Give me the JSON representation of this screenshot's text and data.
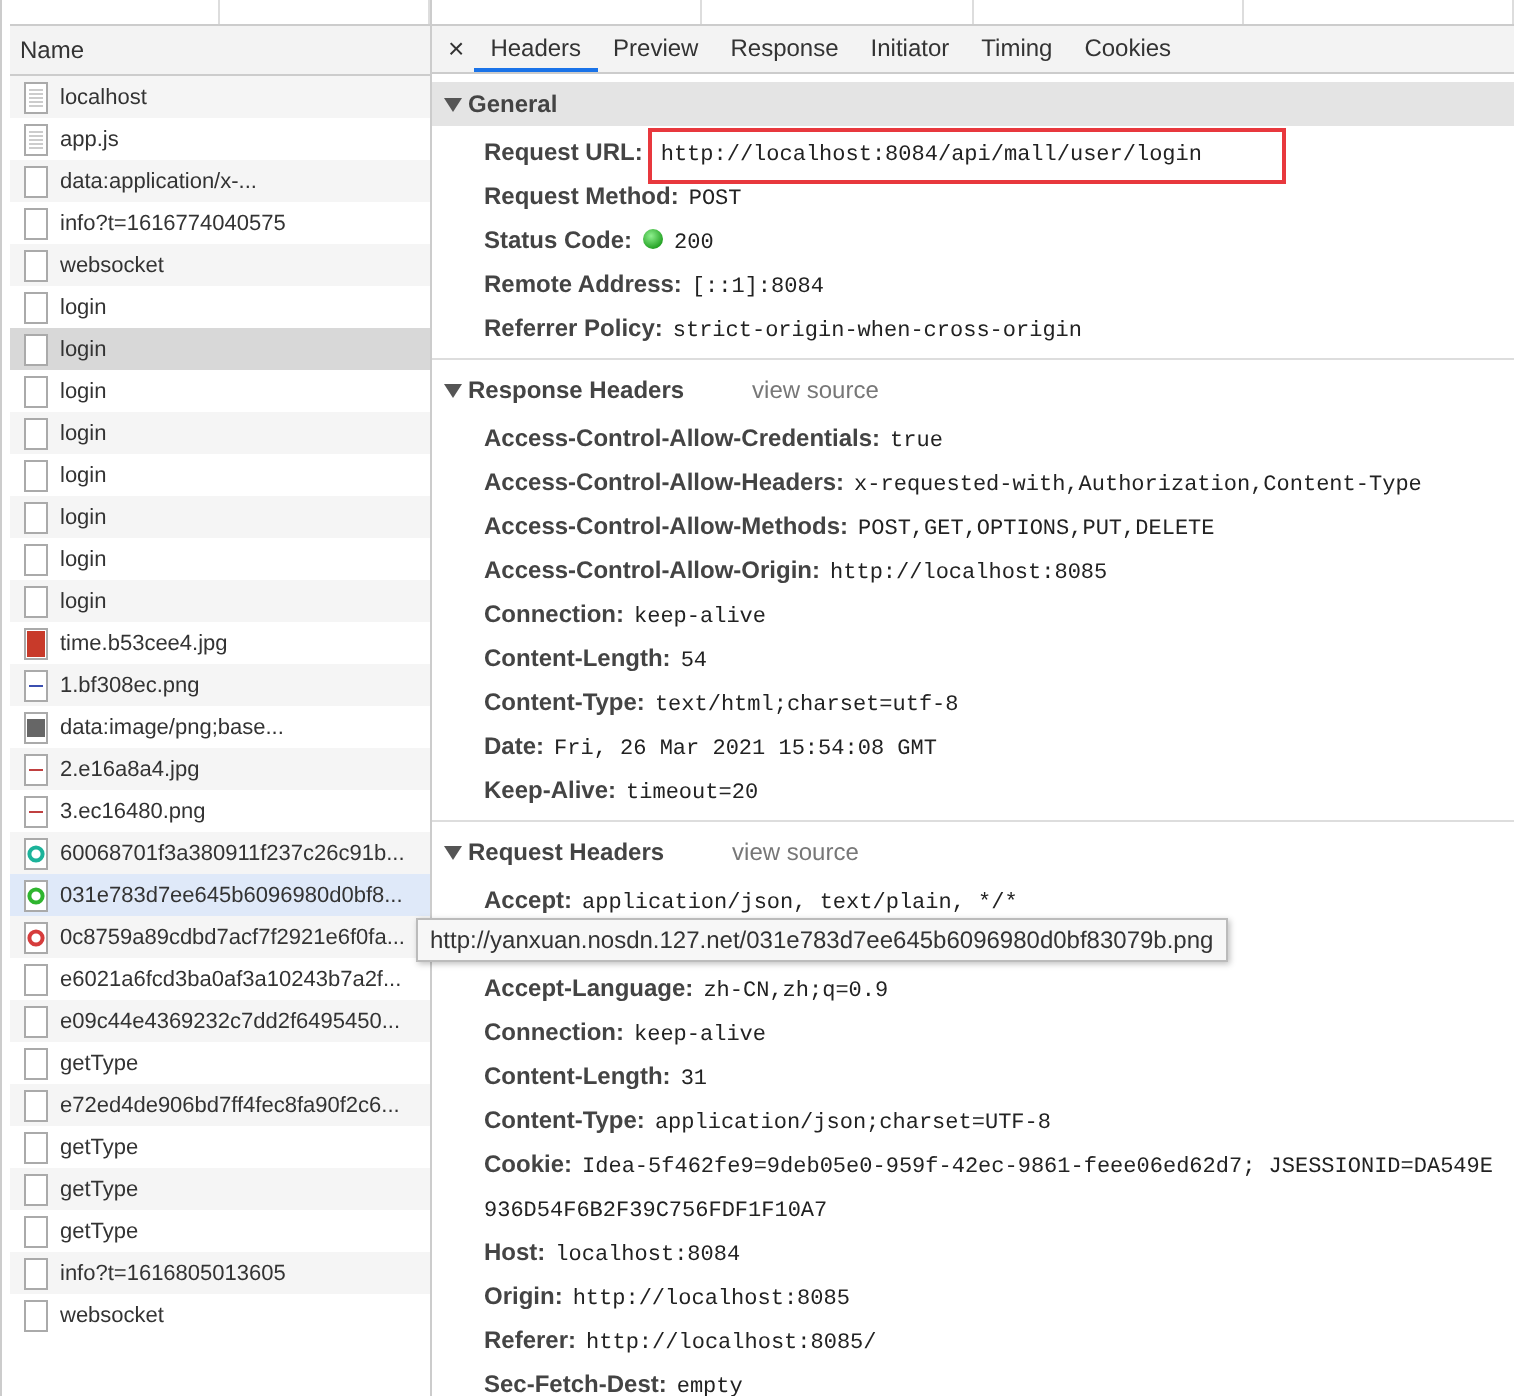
{
  "requests": {
    "column": "Name",
    "rows": [
      {
        "name": "localhost",
        "kind": "document",
        "selected": false,
        "hovered": false
      },
      {
        "name": "app.js",
        "kind": "document",
        "selected": false,
        "hovered": false
      },
      {
        "name": "data:application/x-...",
        "kind": "blank",
        "selected": false,
        "hovered": false
      },
      {
        "name": "info?t=1616774040575",
        "kind": "blank",
        "selected": false,
        "hovered": false
      },
      {
        "name": "websocket",
        "kind": "blank",
        "selected": false,
        "hovered": false
      },
      {
        "name": "login",
        "kind": "blank",
        "selected": false,
        "hovered": false
      },
      {
        "name": "login",
        "kind": "blank",
        "selected": true,
        "hovered": false
      },
      {
        "name": "login",
        "kind": "blank",
        "selected": false,
        "hovered": false
      },
      {
        "name": "login",
        "kind": "blank",
        "selected": false,
        "hovered": false
      },
      {
        "name": "login",
        "kind": "blank",
        "selected": false,
        "hovered": false
      },
      {
        "name": "login",
        "kind": "blank",
        "selected": false,
        "hovered": false
      },
      {
        "name": "login",
        "kind": "blank",
        "selected": false,
        "hovered": false
      },
      {
        "name": "login",
        "kind": "blank",
        "selected": false,
        "hovered": false
      },
      {
        "name": "time.b53cee4.jpg",
        "kind": "photo",
        "selected": false,
        "hovered": false
      },
      {
        "name": "1.bf308ec.png",
        "kind": "line-blue",
        "selected": false,
        "hovered": false
      },
      {
        "name": "data:image/png;base...",
        "kind": "gray",
        "selected": false,
        "hovered": false
      },
      {
        "name": "2.e16a8a4.jpg",
        "kind": "line-red",
        "selected": false,
        "hovered": false
      },
      {
        "name": "3.ec16480.png",
        "kind": "line-red",
        "selected": false,
        "hovered": false
      },
      {
        "name": "60068701f3a380911f237c26c91b...",
        "kind": "ring-teal",
        "selected": false,
        "hovered": false
      },
      {
        "name": "031e783d7ee645b6096980d0bf8...",
        "kind": "ring-green",
        "selected": false,
        "hovered": true
      },
      {
        "name": "0c8759a89cdbd7acf7f2921e6f0fa...",
        "kind": "ring-red",
        "selected": false,
        "hovered": false
      },
      {
        "name": "e6021a6fcd3ba0af3a10243b7a2f...",
        "kind": "blank",
        "selected": false,
        "hovered": false
      },
      {
        "name": "e09c44e4369232c7dd2f6495450...",
        "kind": "blank",
        "selected": false,
        "hovered": false
      },
      {
        "name": "getType",
        "kind": "blank",
        "selected": false,
        "hovered": false
      },
      {
        "name": "e72ed4de906bd7ff4fec8fa90f2c6...",
        "kind": "blank",
        "selected": false,
        "hovered": false
      },
      {
        "name": "getType",
        "kind": "blank",
        "selected": false,
        "hovered": false
      },
      {
        "name": "getType",
        "kind": "blank",
        "selected": false,
        "hovered": false
      },
      {
        "name": "getType",
        "kind": "blank",
        "selected": false,
        "hovered": false
      },
      {
        "name": "info?t=1616805013605",
        "kind": "blank",
        "selected": false,
        "hovered": false
      },
      {
        "name": "websocket",
        "kind": "blank",
        "selected": false,
        "hovered": false
      }
    ]
  },
  "close": "×",
  "tabs": [
    {
      "label": "Headers",
      "selected": true
    },
    {
      "label": "Preview",
      "selected": false
    },
    {
      "label": "Response",
      "selected": false
    },
    {
      "label": "Initiator",
      "selected": false
    },
    {
      "label": "Timing",
      "selected": false
    },
    {
      "label": "Cookies",
      "selected": false
    }
  ],
  "sections": [
    {
      "title": "General",
      "expanded": true,
      "rows": [
        {
          "name": "Request URL:",
          "value": "http://localhost:8084/api/mall/user/login",
          "kind": "plain",
          "highlighted": true
        },
        {
          "name": "Request Method:",
          "value": "POST",
          "kind": "plain",
          "highlighted": false
        },
        {
          "name": "Status Code:",
          "value": "200",
          "kind": "status",
          "highlighted": false
        },
        {
          "name": "Remote Address:",
          "value": "[::1]:8084",
          "kind": "plain",
          "highlighted": false
        },
        {
          "name": "Referrer Policy:",
          "value": "strict-origin-when-cross-origin",
          "kind": "plain",
          "highlighted": false
        }
      ]
    },
    {
      "title": "Response Headers",
      "link": "view source",
      "expanded": true,
      "rows": [
        {
          "name": "Access-Control-Allow-Credentials:",
          "value": "true",
          "kind": "plain",
          "highlighted": false
        },
        {
          "name": "Access-Control-Allow-Headers:",
          "value": "x-requested-with,Authorization,Content-Type",
          "kind": "plain",
          "highlighted": false
        },
        {
          "name": "Access-Control-Allow-Methods:",
          "value": "POST,GET,OPTIONS,PUT,DELETE",
          "kind": "plain",
          "highlighted": false
        },
        {
          "name": "Access-Control-Allow-Origin:",
          "value": "http://localhost:8085",
          "kind": "plain",
          "highlighted": false
        },
        {
          "name": "Connection:",
          "value": "keep-alive",
          "kind": "plain",
          "highlighted": false
        },
        {
          "name": "Content-Length:",
          "value": "54",
          "kind": "plain",
          "highlighted": false
        },
        {
          "name": "Content-Type:",
          "value": "text/html;charset=utf-8",
          "kind": "plain",
          "highlighted": false
        },
        {
          "name": "Date:",
          "value": "Fri, 26 Mar 2021 15:54:08 GMT",
          "kind": "plain",
          "highlighted": false
        },
        {
          "name": "Keep-Alive:",
          "value": "timeout=20",
          "kind": "plain",
          "highlighted": false
        }
      ]
    },
    {
      "title": "Request Headers",
      "link": "view source",
      "expanded": true,
      "rows": [
        {
          "name": "Accept:",
          "value": "application/json, text/plain, */*",
          "kind": "plain",
          "highlighted": false
        },
        {
          "name": "Accept-Language:",
          "value": "zh-CN,zh;q=0.9",
          "kind": "plain",
          "highlighted": false
        },
        {
          "name": "Connection:",
          "value": "keep-alive",
          "kind": "plain",
          "highlighted": false
        },
        {
          "name": "Content-Length:",
          "value": "31",
          "kind": "plain",
          "highlighted": false
        },
        {
          "name": "Content-Type:",
          "value": "application/json;charset=UTF-8",
          "kind": "plain",
          "highlighted": false
        },
        {
          "name": "Cookie:",
          "value": "Idea-5f462fe9=9deb05e0-959f-42ec-9861-feee06ed62d7; JSESSIONID=DA549E936D54F6B2F39C756FDF1F10A7",
          "kind": "wrapped",
          "highlighted": false
        },
        {
          "name": "Host:",
          "value": "localhost:8084",
          "kind": "plain",
          "highlighted": false
        },
        {
          "name": "Origin:",
          "value": "http://localhost:8085",
          "kind": "plain",
          "highlighted": false
        },
        {
          "name": "Referer:",
          "value": "http://localhost:8085/",
          "kind": "plain",
          "highlighted": false
        },
        {
          "name": "Sec-Fetch-Dest:",
          "value": "empty",
          "kind": "plain",
          "highlighted": false
        }
      ]
    }
  ],
  "tooltip": "http://yanxuan.nosdn.127.net/031e783d7ee645b6096980d0bf83079b.png"
}
